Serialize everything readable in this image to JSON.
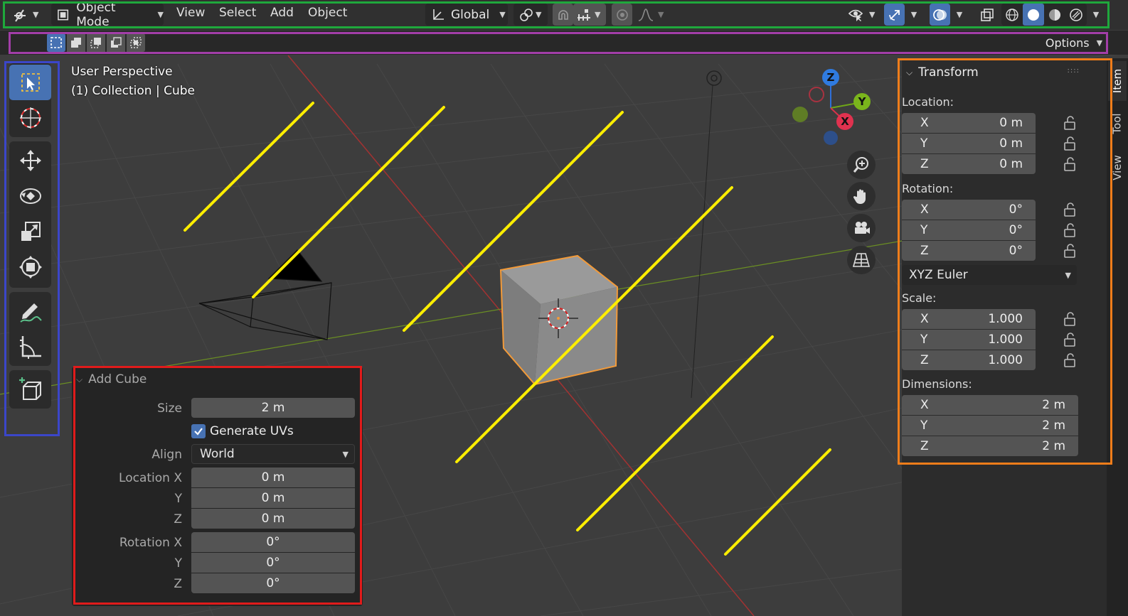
{
  "header": {
    "mode_label": "Object Mode",
    "menus": [
      "View",
      "Select",
      "Add",
      "Object"
    ],
    "orientation_label": "Global"
  },
  "tool_settings": {
    "options_label": "Options"
  },
  "viewport": {
    "perspective_label": "User Perspective",
    "collection_label": "(1) Collection | Cube",
    "gizmo_axes": {
      "z": "Z",
      "y": "Y",
      "x": "X"
    }
  },
  "npanel": {
    "tabs": [
      "Item",
      "Tool",
      "View"
    ],
    "transform_title": "Transform",
    "location_label": "Location:",
    "location": [
      {
        "axis": "X",
        "value": "0 m"
      },
      {
        "axis": "Y",
        "value": "0 m"
      },
      {
        "axis": "Z",
        "value": "0 m"
      }
    ],
    "rotation_label": "Rotation:",
    "rotation": [
      {
        "axis": "X",
        "value": "0°"
      },
      {
        "axis": "Y",
        "value": "0°"
      },
      {
        "axis": "Z",
        "value": "0°"
      }
    ],
    "rotation_mode": "XYZ Euler",
    "scale_label": "Scale:",
    "scale": [
      {
        "axis": "X",
        "value": "1.000"
      },
      {
        "axis": "Y",
        "value": "1.000"
      },
      {
        "axis": "Z",
        "value": "1.000"
      }
    ],
    "dimensions_label": "Dimensions:",
    "dimensions": [
      {
        "axis": "X",
        "value": "2 m"
      },
      {
        "axis": "Y",
        "value": "2 m"
      },
      {
        "axis": "Z",
        "value": "2 m"
      }
    ]
  },
  "redo_panel": {
    "title": "Add Cube",
    "size_label": "Size",
    "size_value": "2 m",
    "generate_uvs_label": "Generate UVs",
    "generate_uvs_checked": true,
    "align_label": "Align",
    "align_value": "World",
    "location_x_label": "Location X",
    "location_y_label": "Y",
    "location_z_label": "Z",
    "location_x": "0 m",
    "location_y": "0 m",
    "location_z": "0 m",
    "rotation_x_label": "Rotation X",
    "rotation_y_label": "Y",
    "rotation_z_label": "Z",
    "rotation_x": "0°",
    "rotation_y": "0°",
    "rotation_z": "0°"
  },
  "colors": {
    "accent": "#4772b3",
    "annotation_green": "#1fa83c",
    "annotation_purple": "#a23ea8",
    "annotation_blue": "#3b46c9",
    "annotation_orange": "#f07d1a",
    "annotation_red": "#e01b1b",
    "highlight_lines": "#ffee00"
  }
}
